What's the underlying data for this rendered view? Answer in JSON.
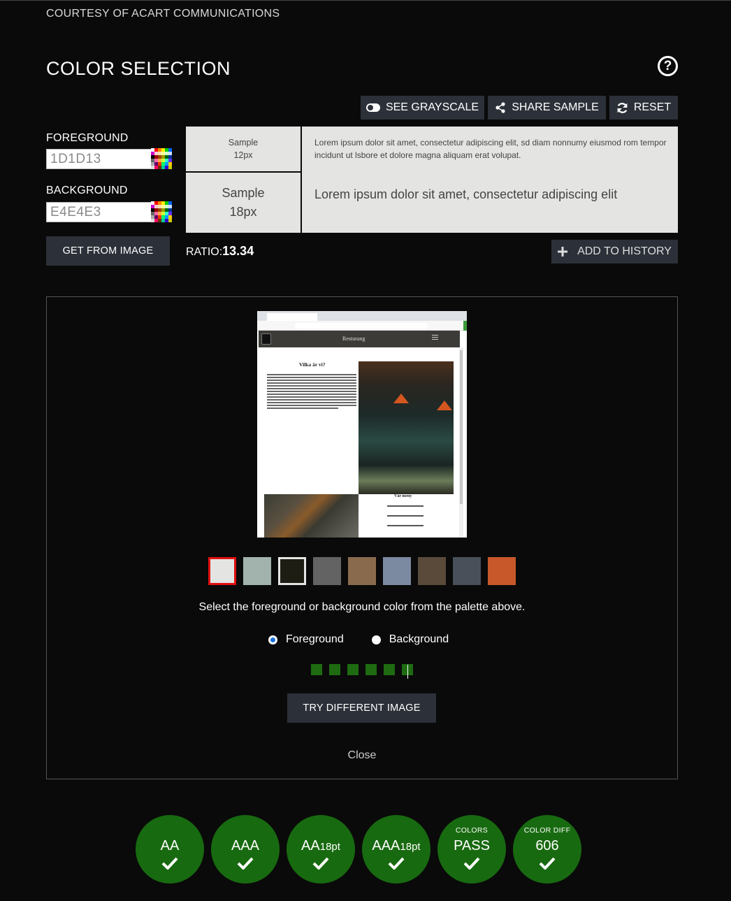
{
  "header": {
    "courtesy": "COURTESY OF ACART COMMUNICATIONS",
    "title": "COLOR SELECTION",
    "help_icon": "question-circle-icon"
  },
  "toolbar": {
    "grayscale_label": "SEE GRAYSCALE",
    "share_label": "SHARE SAMPLE",
    "reset_label": "RESET"
  },
  "foreground": {
    "label": "FOREGROUND",
    "value": "1D1D13"
  },
  "background": {
    "label": "BACKGROUND",
    "value": "E4E4E3"
  },
  "get_from_image_label": "GET FROM IMAGE",
  "sample": {
    "small_label_1": "Sample",
    "small_label_2": "12px",
    "large_label_1": "Sample",
    "large_label_2": "18px",
    "small_text": "Lorem ipsum dolor sit amet, consectetur adipiscing elit, sd diam nonnumy eiusmod rom tempor incidunt ut lsbore et dolore magna aliquam erat volupat.",
    "large_text": "Lorem ipsum dolor sit amet, consectetur adipiscing elit"
  },
  "ratio": {
    "label": "RATIO:",
    "value": "13.34"
  },
  "add_history_label": "ADD TO HISTORY",
  "image_preview": {
    "brand": "Resturang",
    "heading": "Vilka är vi?",
    "menu_title": "Vår meny"
  },
  "palette": [
    "#e4e4e3",
    "#a2b2ac",
    "#1d1d13",
    "#636363",
    "#8a6a4c",
    "#7b8aa0",
    "#5a4a3a",
    "#4a505a",
    "#c8582a"
  ],
  "instruction": "Select the foreground or background color from the palette above.",
  "radio": {
    "foreground_label": "Foreground",
    "background_label": "Background",
    "selected": "Foreground"
  },
  "try_image_label": "TRY DIFFERENT IMAGE",
  "close_label": "Close",
  "results": {
    "aa": {
      "main": "AA"
    },
    "aaa": {
      "main": "AAA"
    },
    "aa18": {
      "main": "AA",
      "sub": "18pt"
    },
    "aaa18": {
      "main": "AAA",
      "sub": "18pt"
    },
    "colors": {
      "top": "COLORS",
      "main": "PASS"
    },
    "diff": {
      "top": "COLOR DIFF",
      "main": "606"
    }
  },
  "colors": {
    "pass_green": "#186a10",
    "button_dark": "#2c3038",
    "accent_red": "#e01010"
  }
}
